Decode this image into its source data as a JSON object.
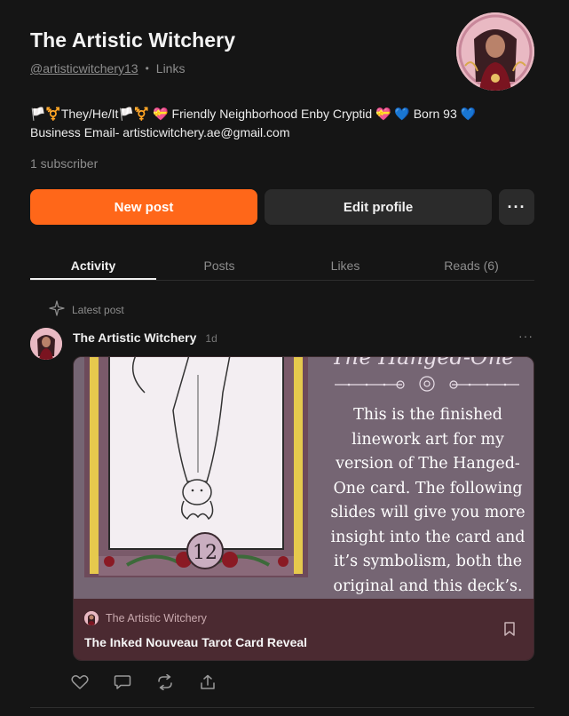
{
  "profile": {
    "name": "The Artistic Witchery",
    "handle": "@artisticwitchery13",
    "separator": "•",
    "links_label": "Links",
    "bio_line1": "🏳️⚧️They/He/It🏳️⚧️ 💝 Friendly Neighborhood Enby Cryptid 💝  💙 Born 93 💙",
    "bio_line2": "Business Email- artisticwitchery.ae@gmail.com",
    "subscribers": "1 subscriber"
  },
  "buttons": {
    "new_post": "New post",
    "edit_profile": "Edit profile",
    "more": "···"
  },
  "tabs": [
    {
      "label": "Activity",
      "active": true
    },
    {
      "label": "Posts",
      "active": false
    },
    {
      "label": "Likes",
      "active": false
    },
    {
      "label": "Reads (6)",
      "active": false
    }
  ],
  "feed": {
    "latest_label": "Latest post",
    "post": {
      "author": "The Artistic Witchery",
      "time": "1d",
      "more": "···",
      "card": {
        "script_title": "The Hanged-One",
        "card_number": "12",
        "image_text": "This is the finished linework art for my version of The Hanged-One card. The following slides will give you more insight into the card and it’s symbolism, both the original and this deck’s.",
        "author": "The Artistic Witchery",
        "title": "The Inked Nouveau Tarot Card Reveal"
      }
    }
  },
  "icons": {
    "sparkle": "sparkle-icon",
    "more": "more-horizontal-icon",
    "bookmark": "bookmark-icon",
    "like": "heart-icon",
    "comment": "comment-icon",
    "restack": "restack-icon",
    "share": "share-icon"
  },
  "colors": {
    "background": "#151515",
    "accent": "#ff6719",
    "secondary_button": "#2b2b2b",
    "card_footer": "#4b2a31",
    "card_image_bg": "#756573"
  }
}
